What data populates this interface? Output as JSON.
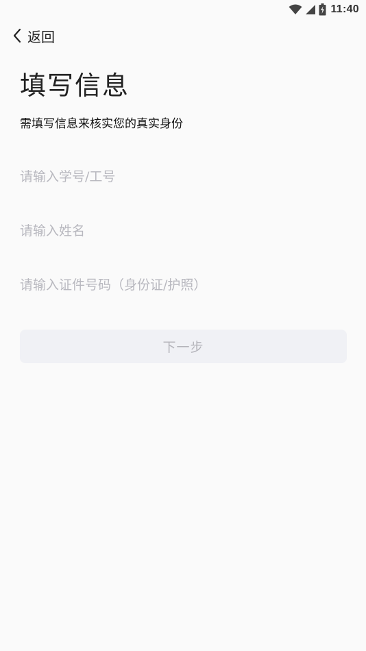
{
  "status_bar": {
    "time": "11:40",
    "icons": [
      "wifi-icon",
      "cell-signal-icon",
      "battery-icon"
    ]
  },
  "nav": {
    "back_label": "返回",
    "back_icon": "chevron-left-icon"
  },
  "header": {
    "title": "填写信息",
    "subtitle": "需填写信息来核实您的真实身份"
  },
  "form": {
    "student_id": {
      "value": "",
      "placeholder": "请输入学号/工号"
    },
    "name": {
      "value": "",
      "placeholder": "请输入姓名"
    },
    "id_number": {
      "value": "",
      "placeholder": "请输入证件号码（身份证/护照）"
    }
  },
  "actions": {
    "next_label": "下一步"
  },
  "colors": {
    "background": "#fafafa",
    "placeholder": "#b8b8bf",
    "button_bg": "#f0f1f5",
    "button_text": "#b4b4ba"
  }
}
